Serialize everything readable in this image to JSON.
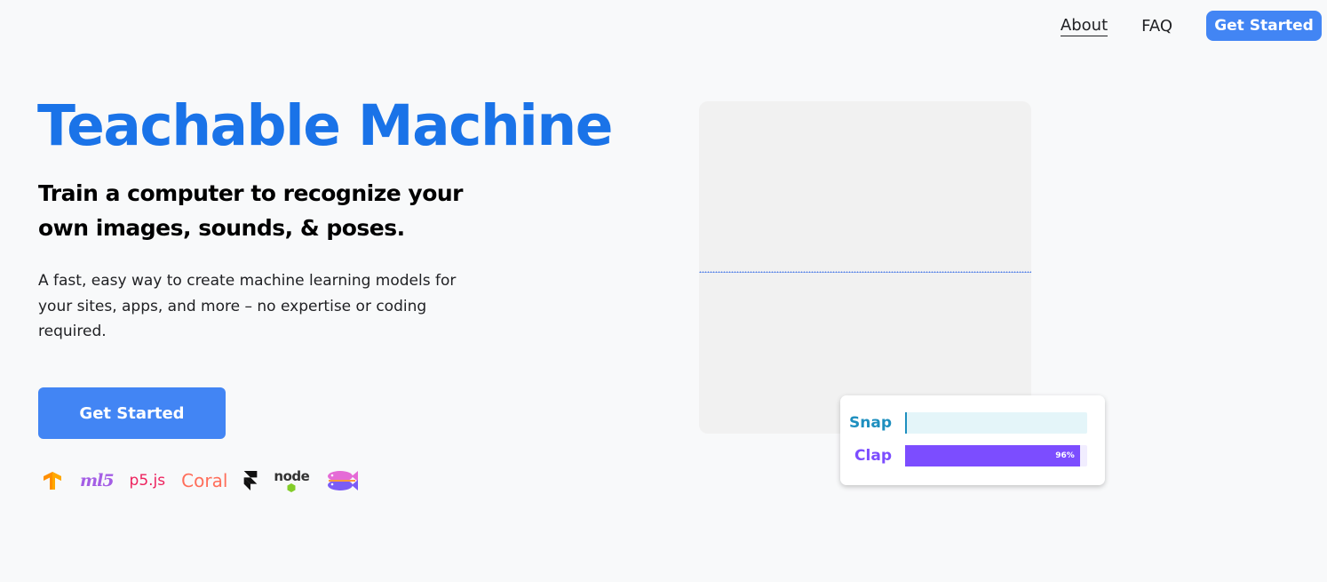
{
  "nav": {
    "about": "About",
    "faq": "FAQ",
    "get_started": "Get Started"
  },
  "hero": {
    "title": "Teachable Machine",
    "subtitle": "Train a computer to recognize your own images, sounds, & poses.",
    "description": "A fast, easy way to create machine learning models for your sites, apps, and more – no expertise or coding required.",
    "cta": "Get Started"
  },
  "logos": {
    "ml5": "ml5",
    "p5": "p5.js",
    "coral": "Coral",
    "node": "node"
  },
  "demo": {
    "classes": [
      {
        "label": "Snap",
        "confidence": 0.0,
        "percent_text": "",
        "color": "#1e8fbf",
        "track": "#e4f5f9"
      },
      {
        "label": "Clap",
        "confidence": 0.96,
        "percent_text": "96%",
        "color": "#7c4dff",
        "track": "#f1edff"
      }
    ]
  },
  "colors": {
    "primary": "#4285f4",
    "title": "#1a73e8",
    "coral": "#ff6e5a",
    "p5": "#ed225d",
    "tensorflow": "#ff8f00"
  }
}
